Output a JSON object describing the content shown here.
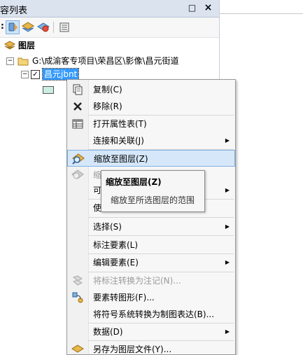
{
  "panel": {
    "title": "容列表",
    "pin_glyph": "□",
    "close_glyph": "×"
  },
  "toolbar": {
    "icons": [
      "list-by-drawing-order-icon",
      "list-by-source-icon",
      "list-by-visibility-icon",
      "list-by-selection-icon",
      "options-icon"
    ],
    "overflow_glyph": ":"
  },
  "tree": {
    "root_label": "图层",
    "folder_label": "G:\\成渝客专项目\\荣昌区\\影像\\昌元街道",
    "layer_label": "昌元jbnt",
    "collapse_glyph": "−",
    "check_glyph": "✓",
    "symbol_color": "#cdeee2"
  },
  "context_menu": {
    "items": [
      {
        "label": "复制(C)",
        "icon": "copy-icon",
        "disabled": false,
        "submenu": false
      },
      {
        "label": "移除(R)",
        "icon": "remove-icon",
        "disabled": false,
        "submenu": false
      },
      {
        "label": "打开属性表(T)",
        "icon": "table-icon",
        "disabled": false,
        "submenu": false
      },
      {
        "label": "连接和关联(J)",
        "icon": "",
        "disabled": false,
        "submenu": true
      },
      {
        "label": "缩放至图层(Z)",
        "icon": "zoom-to-layer-icon",
        "disabled": false,
        "submenu": false,
        "highlighted": true
      },
      {
        "label": "缩",
        "icon": "zoom-visible-icon",
        "disabled": true,
        "submenu": false
      },
      {
        "label": "可",
        "icon": "",
        "disabled": false,
        "submenu": true
      },
      {
        "label": "使",
        "icon": "",
        "disabled": false,
        "submenu": false
      },
      {
        "label": "选择(S)",
        "icon": "",
        "disabled": false,
        "submenu": true
      },
      {
        "label": "标注要素(L)",
        "icon": "",
        "disabled": false,
        "submenu": false
      },
      {
        "label": "编辑要素(E)",
        "icon": "",
        "disabled": false,
        "submenu": true
      },
      {
        "label": "将标注转换为注记(N)...",
        "icon": "convert-labels-icon",
        "disabled": true,
        "submenu": false
      },
      {
        "label": "要素转图形(F)...",
        "icon": "features-to-graphics-icon",
        "disabled": false,
        "submenu": false
      },
      {
        "label": "将符号系统转换为制图表达(B)...",
        "icon": "",
        "disabled": false,
        "submenu": false
      },
      {
        "label": "数据(D)",
        "icon": "",
        "disabled": false,
        "submenu": true
      },
      {
        "label": "另存为图层文件(Y)...",
        "icon": "save-layer-file-icon",
        "disabled": false,
        "submenu": false
      }
    ],
    "submenu_arrow": "▶"
  },
  "tooltip": {
    "title": "缩放至图层(Z)",
    "description": "缩放至所选图层的范围"
  },
  "colors": {
    "highlight": "#d5e7f9",
    "highlight_border": "#7fb2e6",
    "selected_layer": "#3399ff"
  }
}
